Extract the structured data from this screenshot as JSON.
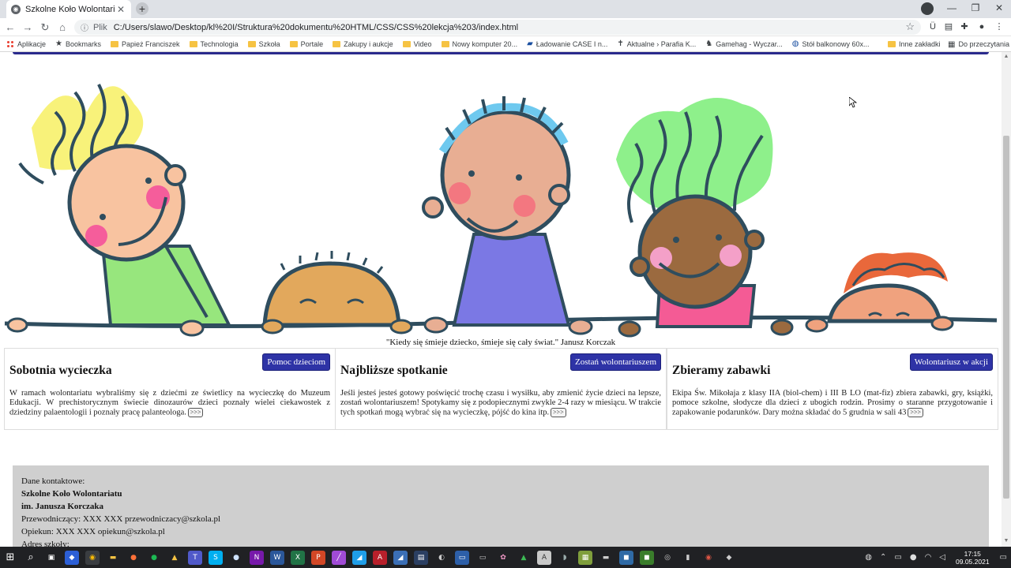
{
  "browser": {
    "tab_title": "Szkolne Koło Wolontariatu",
    "tab_close": "✕",
    "new_tab": "+",
    "minimize": "—",
    "maximize": "❐",
    "close": "✕",
    "back": "←",
    "forward": "→",
    "reload": "↻",
    "home": "⌂",
    "url_scheme": "Plik",
    "url": "C:/Users/slawo/Desktop/kl%20I/Struktura%20dokumentu%20HTML/CSS/CSS%20lekcja%203/index.html",
    "bookmark_star": "☆",
    "menu": "⋮"
  },
  "bookmarks": {
    "items": [
      {
        "label": "Aplikacje",
        "icon": "apps-grid-icon"
      },
      {
        "label": "Bookmarks",
        "icon": "star-icon"
      },
      {
        "label": "Papież Franciszek",
        "icon": "folder-icon"
      },
      {
        "label": "Technologia",
        "icon": "folder-icon"
      },
      {
        "label": "Szkoła",
        "icon": "folder-icon"
      },
      {
        "label": "Portale",
        "icon": "folder-icon"
      },
      {
        "label": "Zakupy i aukcje",
        "icon": "folder-icon"
      },
      {
        "label": "Video",
        "icon": "folder-icon"
      },
      {
        "label": "Nowy komputer 20...",
        "icon": "folder-icon"
      },
      {
        "label": "Ładowanie CASE I n...",
        "icon": "site-icon"
      },
      {
        "label": "Aktualne › Parafia K...",
        "icon": "site-icon"
      },
      {
        "label": "Gamehag - Wyczar...",
        "icon": "site-icon"
      },
      {
        "label": "Stół balkonowy 60x...",
        "icon": "site-icon"
      }
    ],
    "other": "Inne zakładki",
    "reading": "Do przeczytania"
  },
  "page": {
    "quote": "\"Kiedy się śmieje dziecko, śmieje się cały świat.\" Janusz Korczak",
    "cards": [
      {
        "title": "Sobotnia wycieczka",
        "button": "Pomoc dzieciom",
        "text": "W ramach wolontariatu wybraliśmy się z dziećmi ze świetlicy na wycieczkę do Muzeum Edukacji. W prechistorycznym świecie dinozaurów dzieci poznały wielei ciekawostek z dziedziny palaentologii i poznały pracę palanteologa.",
        "more": ">>>"
      },
      {
        "title": "Najbliższe spotkanie",
        "button": "Zostań wolontariuszem",
        "text": "Jeśli jesteś jesteś gotowy poświęcić trochę czasu i wysiłku, aby zmienić życie dzieci na lepsze, zostań wolontariuszem! Spotykamy się z podopiecznymi zwykle 2-4 razy w miesiącu. W trakcie tych spotkań mogą wybrać się na wycieczkę, pójść do kina itp.",
        "more": ">>>"
      },
      {
        "title": "Zbieramy zabawki",
        "button": "Wolontariusz w akcji",
        "text": "Ekipa Św. Mikołaja z klasy IIA (biol-chem) i III B LO (mat-fiz) zbiera zabawki, gry, książki, pomoce szkolne, słodycze dla dzieci z ubogich rodzin. Prosimy o staranne przygotowanie i zapakowanie podarunków. Dary można składać do 5 grudnia w sali 43",
        "more": ">>>"
      }
    ],
    "footer": {
      "heading": "Dane kontaktowe:",
      "org_line1": "Szkolne Koło Wolontariatu",
      "org_line2": "im. Janusza Korczaka",
      "chair": "Przewodniczący: XXX XXX przewodniczacy@szkola.pl",
      "guardian": "Opiekun: XXX XXX opiekun@szkola.pl",
      "address": "Adres szkoły:"
    }
  },
  "taskbar": {
    "start": "⊞",
    "search": "⌕",
    "clock_time": "17:15",
    "clock_date": "09.05.2021",
    "notifications": "▭"
  },
  "colors": {
    "card_button": "#2e33a6",
    "footer_bg": "#cfcfcf",
    "nav_line": "#2a2a8c"
  }
}
